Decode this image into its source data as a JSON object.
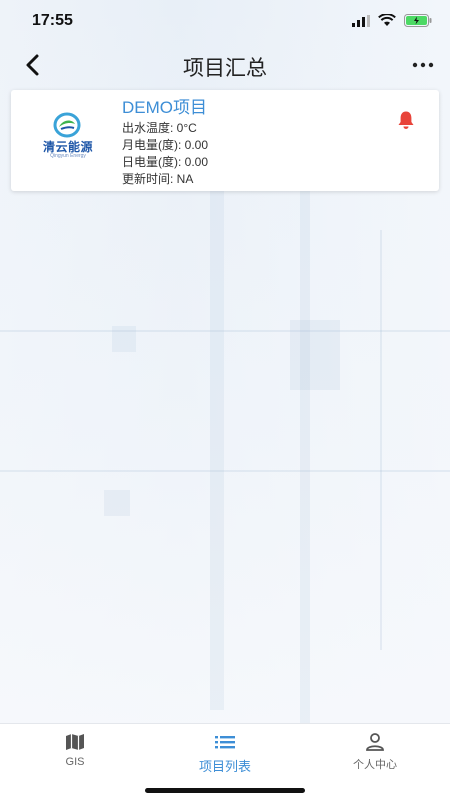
{
  "status_bar": {
    "time": "17:55"
  },
  "nav": {
    "title": "项目汇总"
  },
  "project": {
    "name": "DEMO项目",
    "logo_text": "清云能源",
    "logo_sub": "Qingyun Energy",
    "lines": [
      "出水温度: 0°C",
      "月电量(度): 0.00",
      "日电量(度): 0.00",
      "更新时间: NA"
    ]
  },
  "tabs": [
    {
      "label": "GIS",
      "icon": "map-icon",
      "active": false
    },
    {
      "label": "项目列表",
      "icon": "list-icon",
      "active": true
    },
    {
      "label": "个人中心",
      "icon": "person-icon",
      "active": false
    }
  ],
  "colors": {
    "accent": "#3d8ed6",
    "alert": "#e8443a",
    "logo": "#1f57a8"
  }
}
